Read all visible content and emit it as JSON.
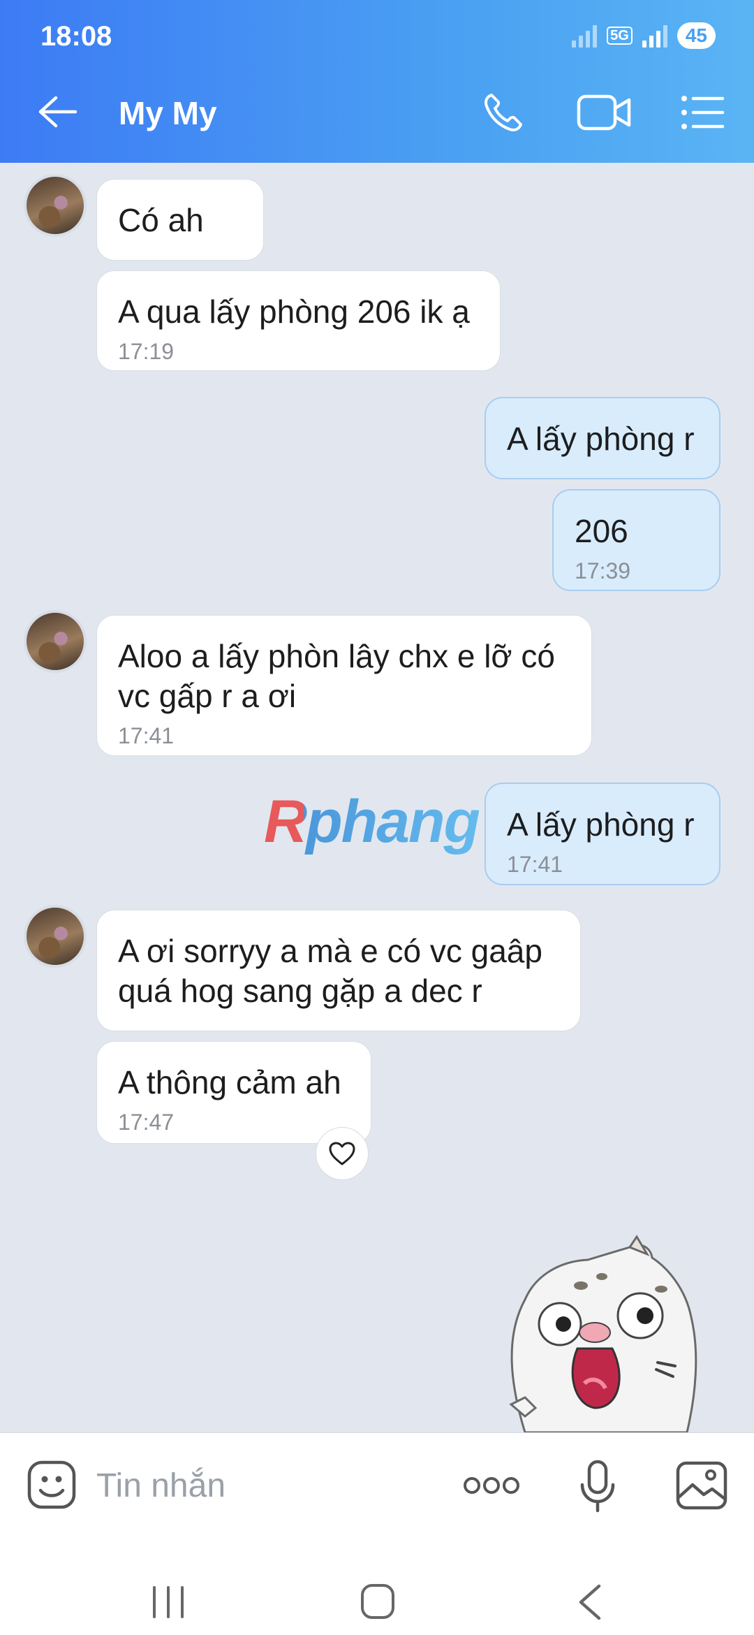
{
  "status_bar": {
    "time": "18:08",
    "network": "5G",
    "battery": "45"
  },
  "header": {
    "contact_name": "My My"
  },
  "messages": [
    {
      "direction": "in",
      "text": "Có ah",
      "time": ""
    },
    {
      "direction": "in",
      "text": "A qua lấy phòng 206 ik ạ",
      "time": "17:19"
    },
    {
      "direction": "out",
      "text": "A lấy phòng r",
      "time": ""
    },
    {
      "direction": "out",
      "text": "206",
      "time": "17:39"
    },
    {
      "direction": "in",
      "text": "Aloo a lấy phòn lây chx e lỡ có vc gấp r a ơi",
      "time": "17:41"
    },
    {
      "direction": "out",
      "text": "A lấy phòng r",
      "time": "17:41"
    },
    {
      "direction": "in",
      "text": "A ơi sorryy a mà e có vc gaâp quá hog sang gặp a dec r",
      "time": ""
    },
    {
      "direction": "in",
      "text": "A thông cảm ah",
      "time": "17:47"
    }
  ],
  "watermark": "Rphang",
  "input": {
    "placeholder": "Tin nhắn",
    "value": ""
  },
  "icons": {
    "back": "back-arrow-icon",
    "call": "phone-icon",
    "video": "video-camera-icon",
    "menu": "list-menu-icon",
    "emoji": "emoji-icon",
    "more": "more-dots-icon",
    "mic": "microphone-icon",
    "image": "image-icon",
    "like": "heart-icon"
  },
  "colors": {
    "header_start": "#3d7bf5",
    "header_end": "#5ab4f4",
    "outgoing_bubble": "#d8ecfc",
    "incoming_bubble": "#ffffff",
    "chat_background": "#e2e7ef"
  }
}
